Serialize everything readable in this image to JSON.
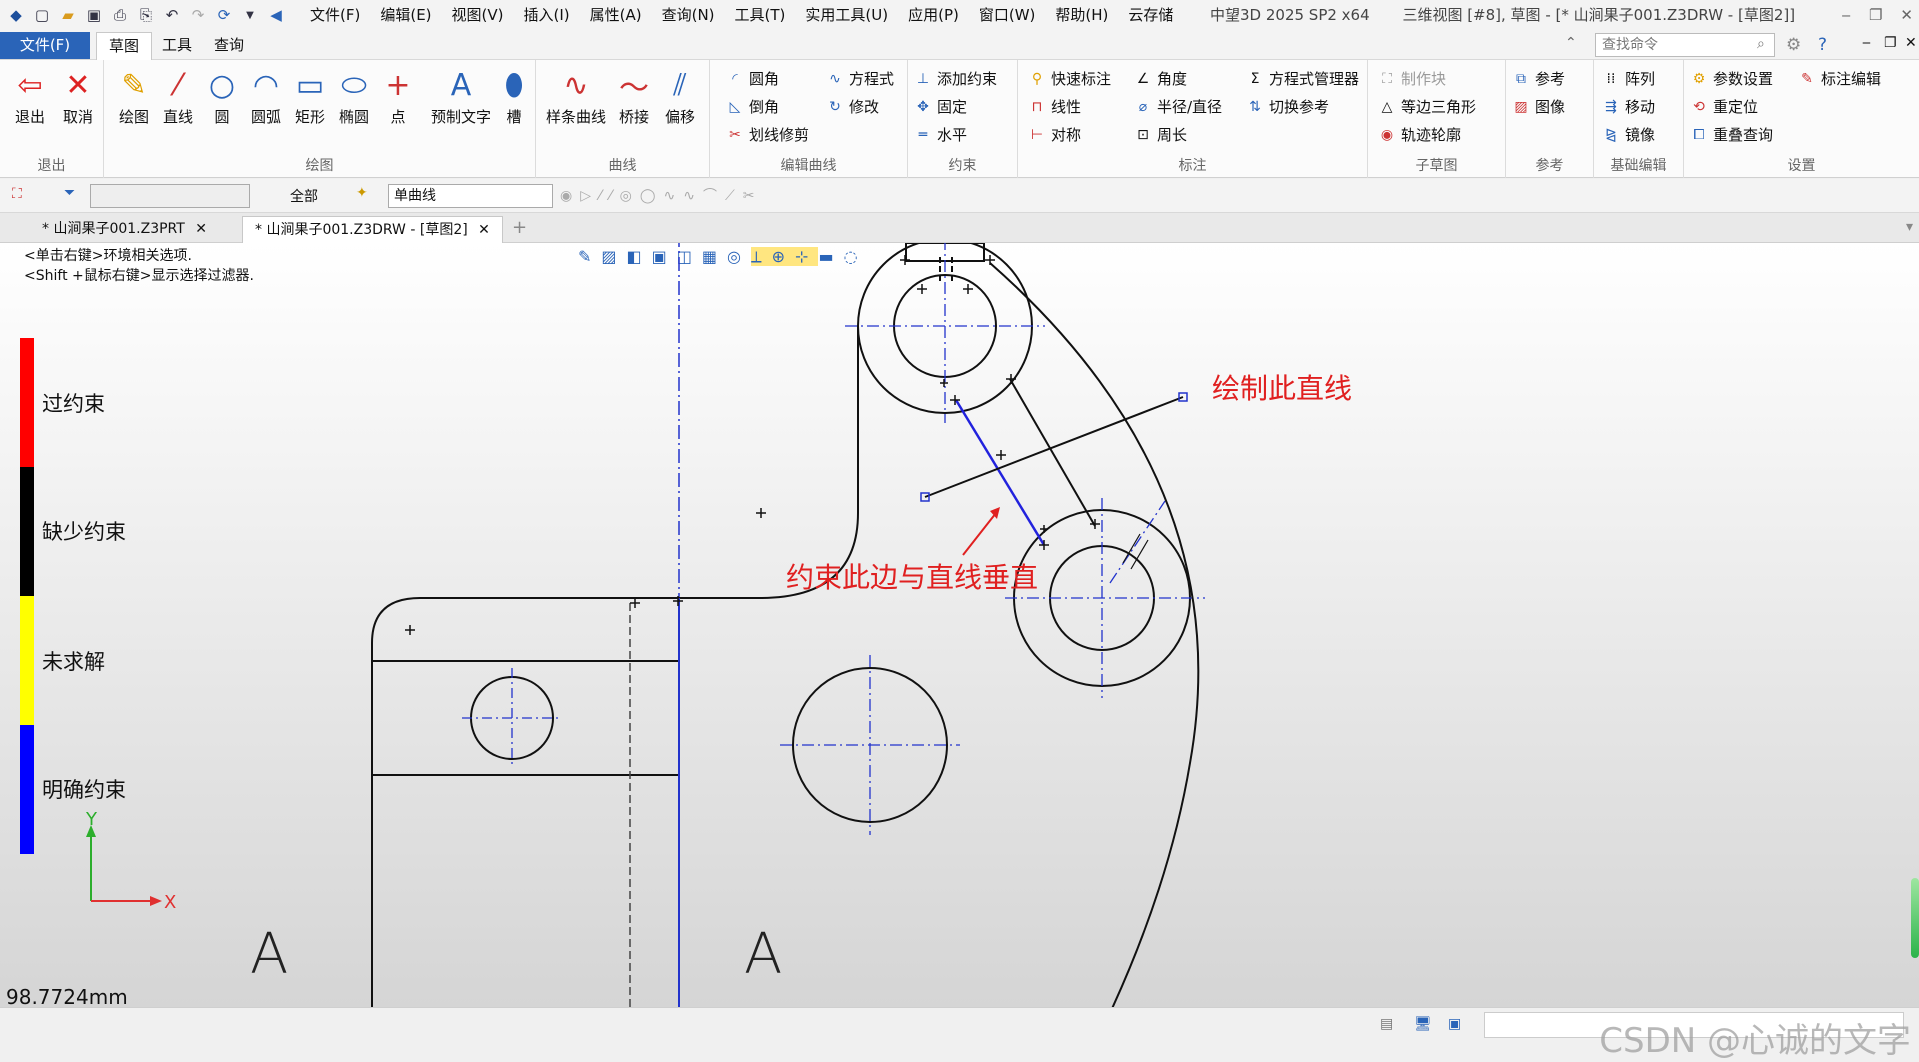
{
  "window": {
    "app_title": "中望3D 2025 SP2 x64",
    "view_title": "三维视图 [#8], 草图 - [* 山涧果子001.Z3DRW - [草图2]]",
    "minimize": "‒",
    "restore": "❐",
    "close": "✕"
  },
  "menu": [
    "文件(F)",
    "编辑(E)",
    "视图(V)",
    "插入(I)",
    "属性(A)",
    "查询(N)",
    "工具(T)",
    "实用工具(U)",
    "应用(P)",
    "窗口(W)",
    "帮助(H)",
    "云存储"
  ],
  "ribbon_tabs": {
    "file": "文件(F)",
    "sketch": "草图",
    "tools": "工具",
    "query": "查询",
    "search_placeholder": "查找命令"
  },
  "ribbon": {
    "exit_group": {
      "label": "退出",
      "exit": "退出",
      "cancel": "取消"
    },
    "draw_group": {
      "label": "绘图",
      "items": [
        "绘图",
        "直线",
        "圆",
        "圆弧",
        "矩形",
        "椭圆",
        "点",
        "预制文字",
        "槽"
      ]
    },
    "curve_group": {
      "label": "曲线",
      "items": [
        "样条曲线",
        "桥接",
        "偏移"
      ]
    },
    "edit_group": {
      "label": "编辑曲线",
      "fillet": "圆角",
      "chamfer": "倒角",
      "trim": "划线修剪",
      "equation": "方程式",
      "modify": "修改"
    },
    "constraint_group": {
      "label": "约束",
      "add": "添加约束",
      "fix": "固定",
      "horizontal": "水平"
    },
    "dimension_group": {
      "label": "标注",
      "quick": "快速标注",
      "linear": "线性",
      "symmetric": "对称",
      "angle": "角度",
      "radius": "半径/直径",
      "perimeter": "周长",
      "eq_manager": "方程式管理器",
      "switch_ref": "切换参考"
    },
    "subsketch_group": {
      "label": "子草图",
      "make_block": "制作块",
      "equilateral": "等边三角形",
      "track": "轨迹轮廓"
    },
    "reference_group": {
      "label": "参考",
      "ref": "参考",
      "image": "图像"
    },
    "base_edit_group": {
      "label": "基础编辑",
      "array": "阵列",
      "move": "移动",
      "mirror": "镜像"
    },
    "settings_group": {
      "label": "设置",
      "param": "参数设置",
      "reposition": "重定位",
      "overlap": "重叠查询",
      "dim_edit": "标注编辑"
    }
  },
  "toolbar2": {
    "filter_all": "全部",
    "curve_mode": "单曲线"
  },
  "doc_tabs": [
    {
      "label": "* 山涧果子001.Z3PRT"
    },
    {
      "label": "* 山涧果子001.Z3DRW - [草图2]"
    }
  ],
  "hints": [
    "<单击右键>环境相关选项.",
    "<Shift +鼠标右键>显示选择过滤器."
  ],
  "legend": [
    {
      "label": "过约束",
      "color": "#ff0000"
    },
    {
      "label": "缺少约束",
      "color": "#000000"
    },
    {
      "label": "未求解",
      "color": "#ffff00"
    },
    {
      "label": "明确约束",
      "color": "#0000ff"
    }
  ],
  "axes": {
    "x": "X",
    "y": "Y"
  },
  "annotations": {
    "draw_line": "绘制此直线",
    "perpendicular": "约束此边与直线垂直"
  },
  "section_mark": "A",
  "measure": "98.7724mm",
  "watermark": "CSDN @心诚的文字"
}
